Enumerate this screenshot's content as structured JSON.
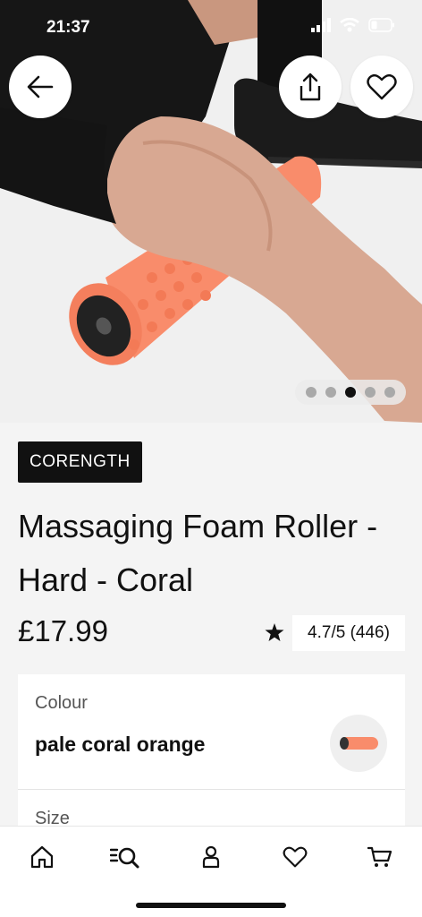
{
  "status_bar": {
    "time": "21:37"
  },
  "hero": {
    "carousel_total": 5,
    "carousel_active": 3
  },
  "product": {
    "brand": "CORENGTH",
    "title": "Massaging Foam Roller - Hard - Coral",
    "price": "£17.99",
    "rating": "4.7/5 (446)"
  },
  "options": {
    "colour_label": "Colour",
    "colour_value": "pale coral orange",
    "size_label": "Size"
  },
  "colors": {
    "accent_coral": "#f98c6b",
    "badge_bg": "#111111",
    "background": "#f4f4f4"
  },
  "tabbar": {
    "items": [
      "home-icon",
      "search-icon",
      "account-icon",
      "wishlist-icon",
      "cart-icon"
    ]
  }
}
